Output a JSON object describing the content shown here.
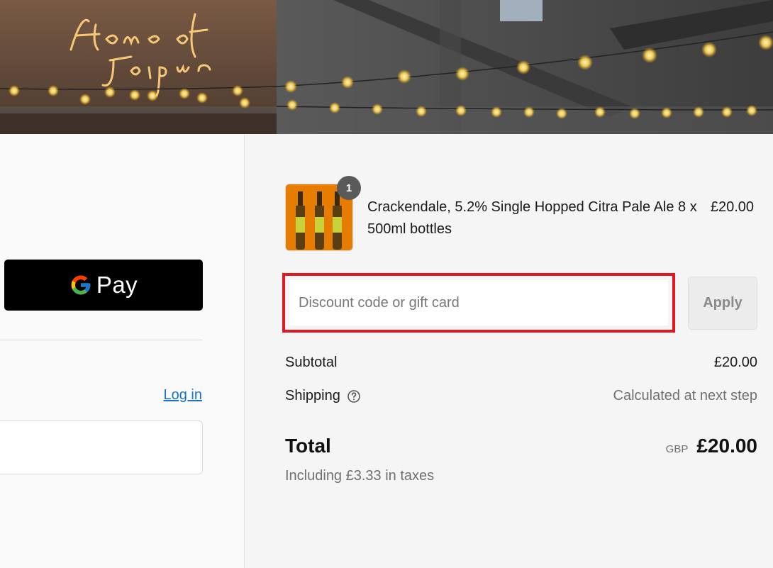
{
  "hero": {
    "sign_line1": "Home of",
    "sign_line2": "Jaipur"
  },
  "express_checkout": {
    "gpay_label": "Pay"
  },
  "account": {
    "login_label": "Log in"
  },
  "cart": {
    "item": {
      "quantity": "1",
      "name": "Crackendale, 5.2% Single Hopped Citra Pale Ale 8 x 500ml bottles",
      "price": "£20.00"
    }
  },
  "discount": {
    "placeholder": "Discount code or gift card",
    "apply_label": "Apply"
  },
  "summary": {
    "subtotal_label": "Subtotal",
    "subtotal_value": "£20.00",
    "shipping_label": "Shipping",
    "shipping_value": "Calculated at next step",
    "total_label": "Total",
    "currency": "GBP",
    "total_value": "£20.00",
    "taxes_note": "Including £3.33 in taxes"
  },
  "colors": {
    "highlight": "#e0181f",
    "link": "#1a73c6",
    "badge": "#5a5a5a"
  }
}
